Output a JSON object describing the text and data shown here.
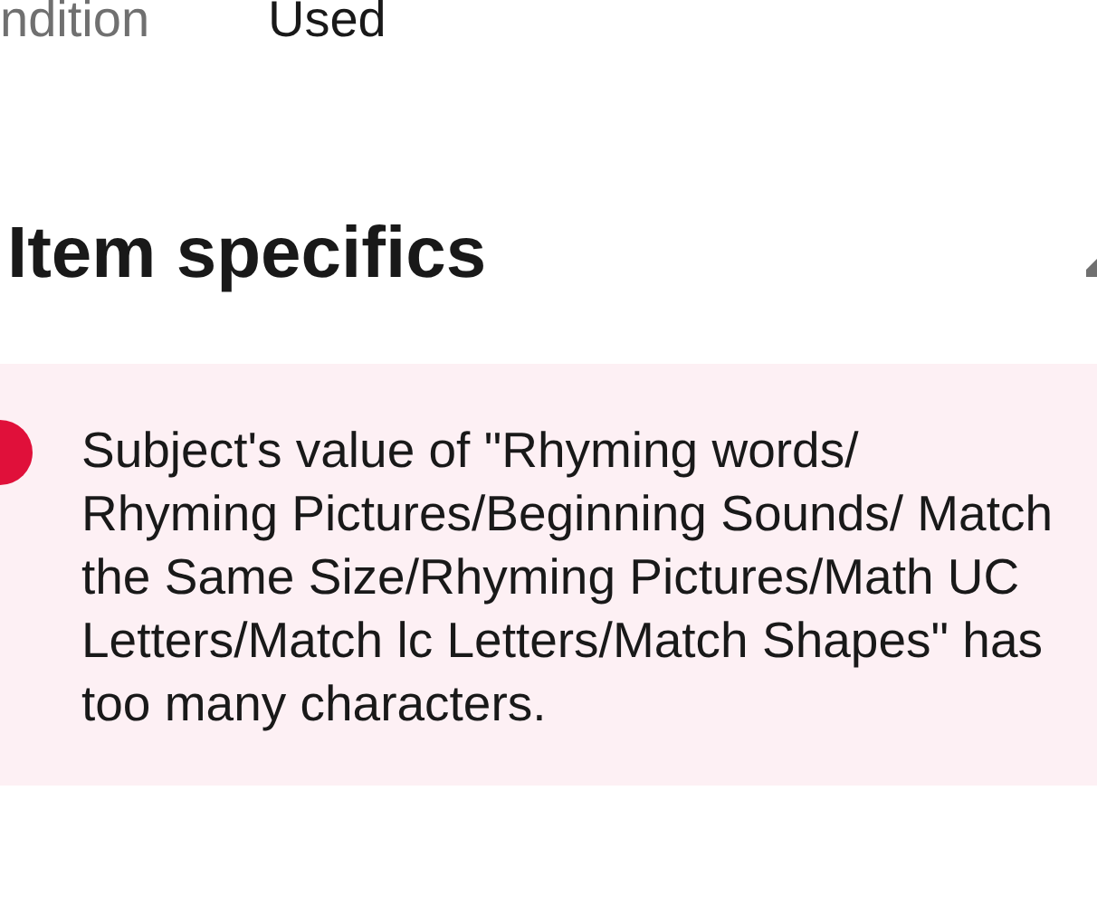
{
  "condition": {
    "label": "ndition",
    "value": "Used"
  },
  "section": {
    "title": "Item specifics"
  },
  "alert": {
    "kind": "error",
    "message": "Subject's value of \"Rhyming words/ Rhyming Pictures/Beginning Sounds/ Match the Same Size/Rhyming Pictures/Math UC Letters/Match lc Letters/Match Shapes\" has too many characters."
  }
}
